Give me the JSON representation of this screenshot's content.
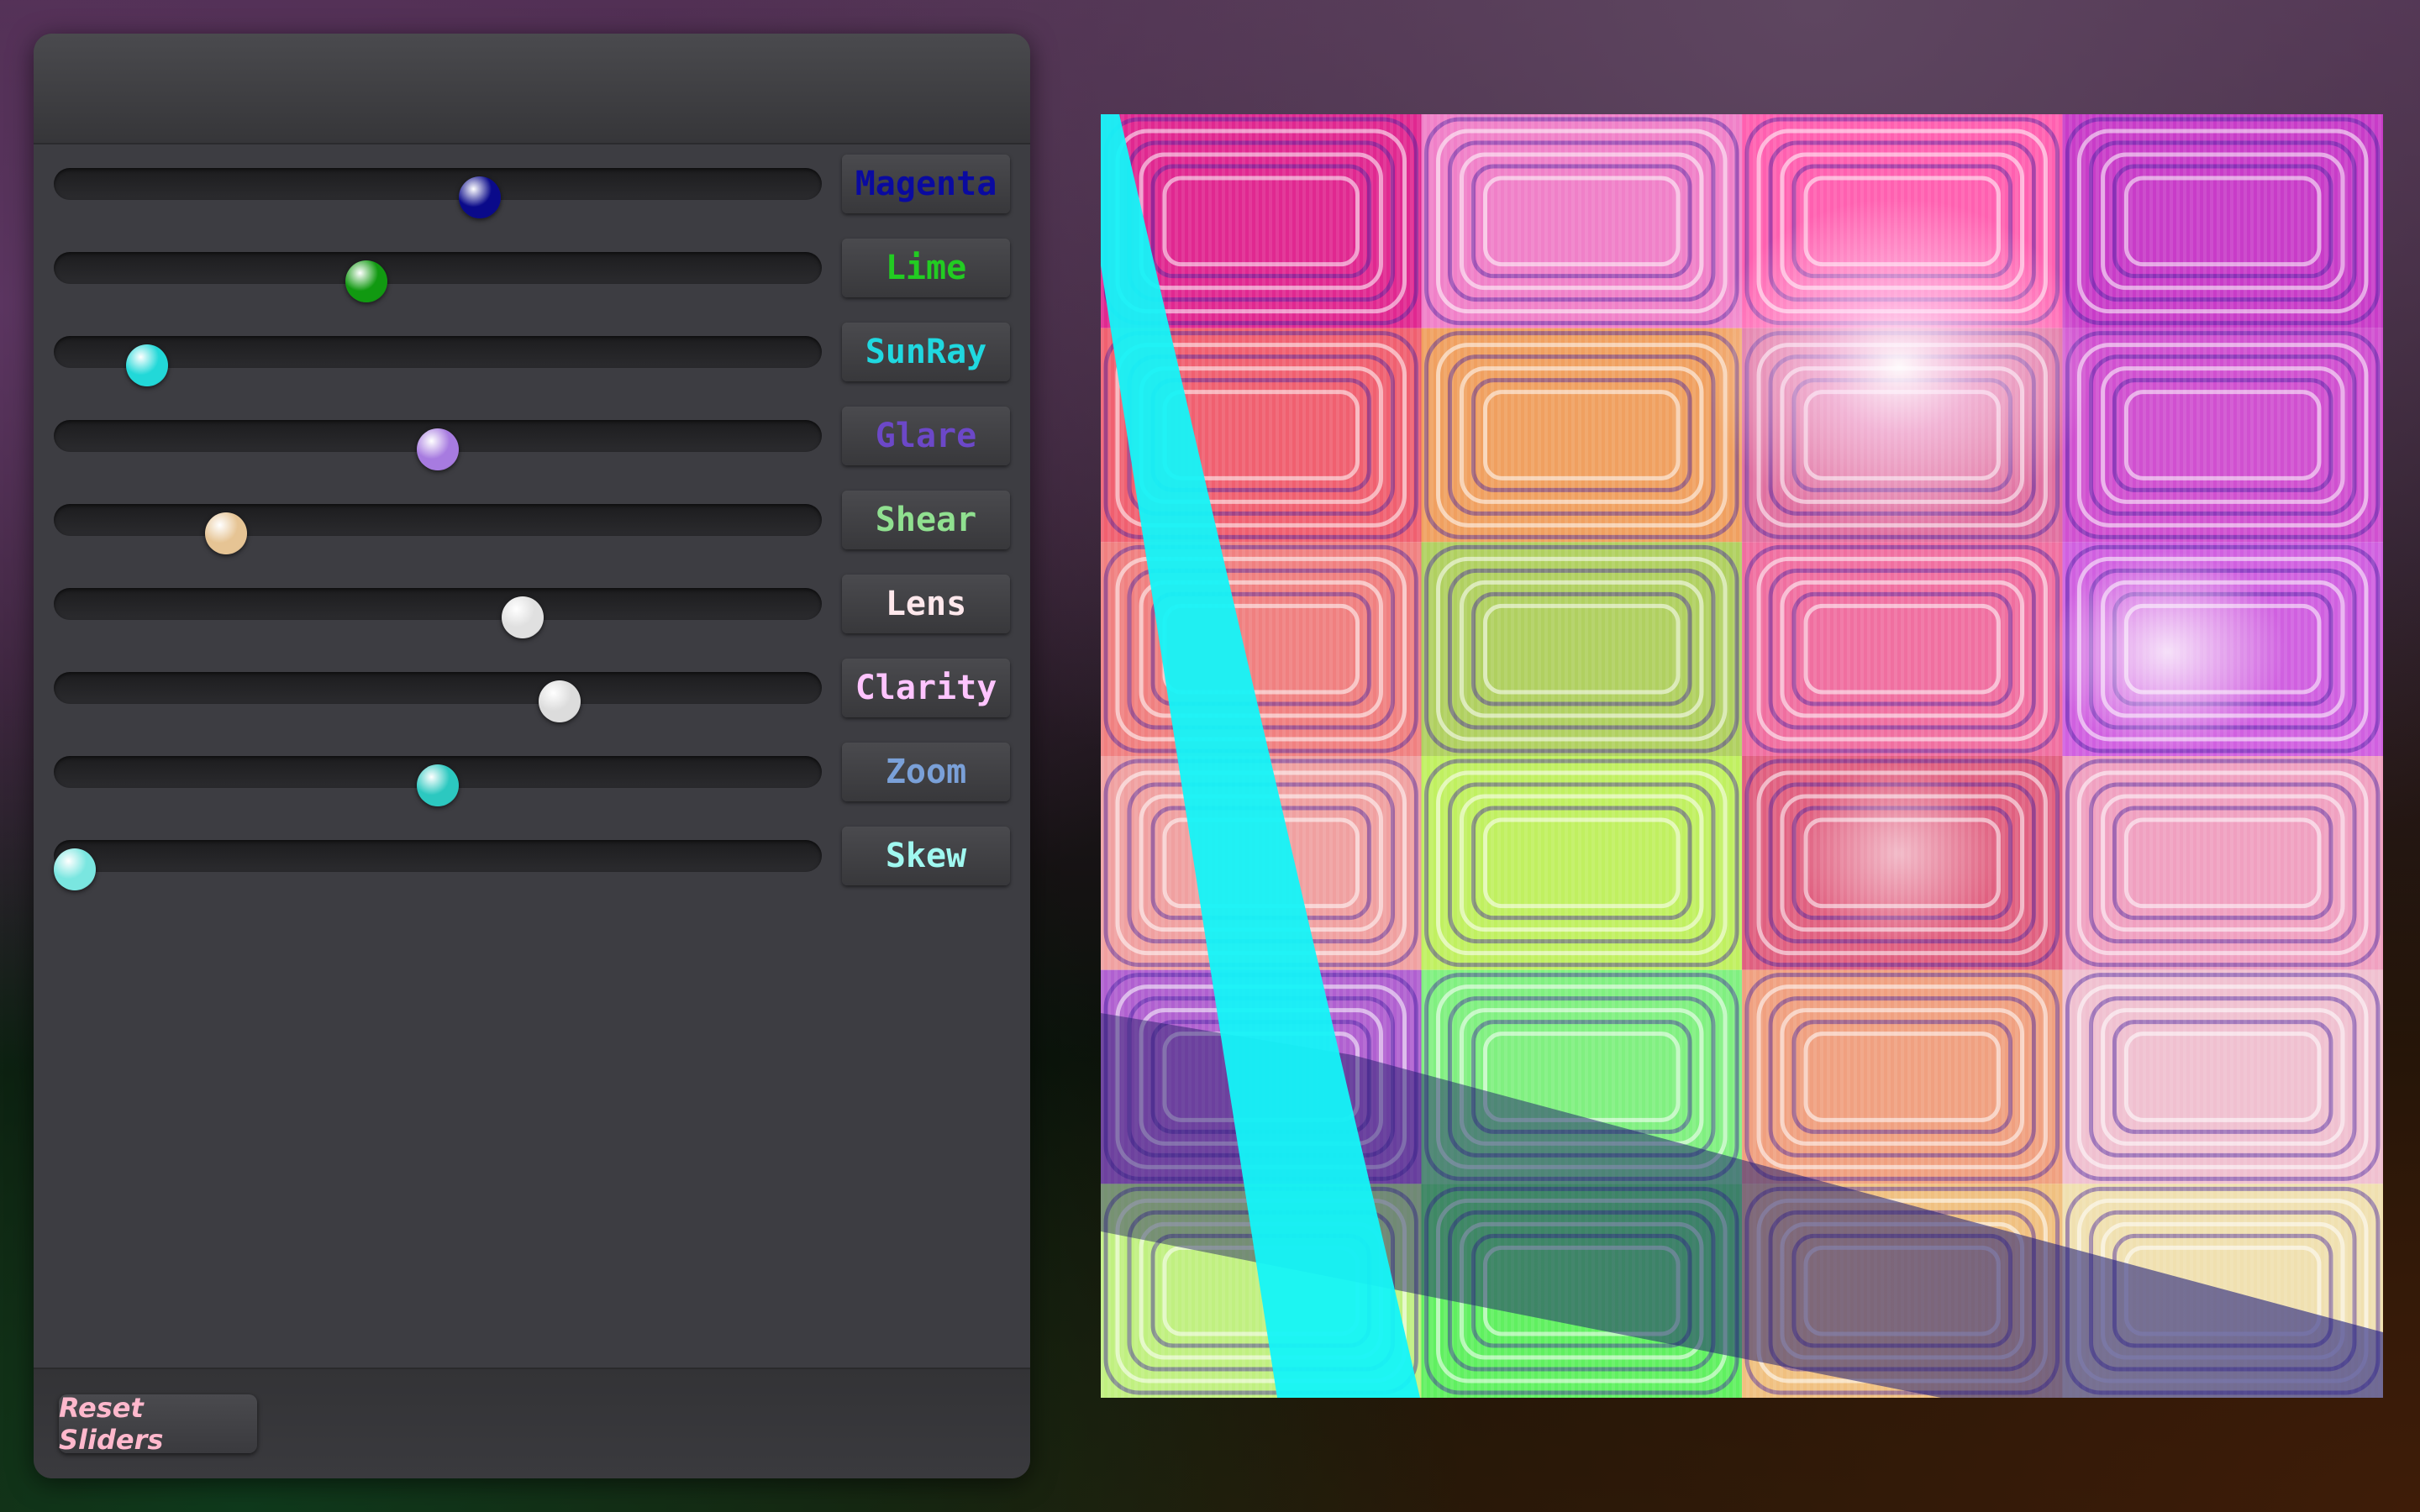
{
  "panel": {
    "sliders": [
      {
        "label": "Magenta",
        "value": 0.555,
        "label_color": "#0a0aa0",
        "thumb_color": "#0a0a8a"
      },
      {
        "label": "Lime",
        "value": 0.407,
        "label_color": "#22cc22",
        "thumb_color": "#119911"
      },
      {
        "label": "SunRay",
        "value": 0.121,
        "label_color": "#20d8e0",
        "thumb_color": "#22d8d8"
      },
      {
        "label": "Glare",
        "value": 0.5,
        "label_color": "#6c48c8",
        "thumb_color": "#a77be0"
      },
      {
        "label": "Shear",
        "value": 0.224,
        "label_color": "#90e090",
        "thumb_color": "#e6c494"
      },
      {
        "label": "Lens",
        "value": 0.611,
        "label_color": "#ffe8ec",
        "thumb_color": "#e0e0e0"
      },
      {
        "label": "Clarity",
        "value": 0.659,
        "label_color": "#ffc4ff",
        "thumb_color": "#dcdcdc"
      },
      {
        "label": "Zoom",
        "value": 0.5,
        "label_color": "#7aa0d8",
        "thumb_color": "#2cc8c0"
      },
      {
        "label": "Skew",
        "value": 0.027,
        "label_color": "#a0f8f0",
        "thumb_color": "#7ae6e0"
      }
    ],
    "reset_label": "Reset Sliders",
    "reset_color": "#ffb8cc"
  }
}
